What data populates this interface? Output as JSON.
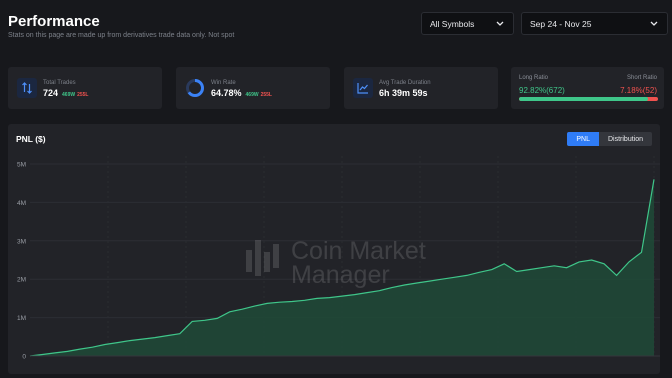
{
  "header": {
    "title": "Performance",
    "subtitle": "Stats on this page are made up from derivatives trade data only. Not spot"
  },
  "filters": {
    "symbol": "All Symbols",
    "date_range": "Sep 24 - Nov 25"
  },
  "stats": {
    "total_trades": {
      "label": "Total Trades",
      "value": "724",
      "win": "469W",
      "loss": "255L",
      "icon": "arrows-updown-icon"
    },
    "win_rate": {
      "label": "Win Rate",
      "value": "64.78%",
      "win": "469W",
      "loss": "255L",
      "fraction": 0.6478,
      "icon": "donut-icon"
    },
    "avg_duration": {
      "label": "Avg Trade Duration",
      "value": "6h 39m 59s",
      "icon": "chart-line-icon"
    },
    "ratio": {
      "long_label": "Long Ratio",
      "short_label": "Short Ratio",
      "long_value": "92.82%(672)",
      "short_value": "7.18%(52)",
      "long_fraction": 0.9282
    }
  },
  "chart": {
    "title": "PNL ($)",
    "tabs": [
      "PNL",
      "Distribution"
    ],
    "active_tab": "PNL",
    "watermark_line1": "Coin Market",
    "watermark_line2": "Manager",
    "colors": {
      "line": "#3fc68a",
      "fill": "#1f4a37",
      "accent": "#2f7cf6",
      "loss": "#f0524f"
    }
  },
  "chart_data": {
    "type": "area",
    "title": "PNL ($)",
    "xlabel": "",
    "ylabel": "",
    "ylim": [
      0,
      5000000
    ],
    "yticks": [
      "0",
      "1M",
      "2M",
      "3M",
      "4M",
      "5M"
    ],
    "ytick_values": [
      0,
      1000000,
      2000000,
      3000000,
      4000000,
      5000000
    ],
    "grid": true,
    "x": [
      0,
      2,
      4,
      6,
      8,
      10,
      12,
      14,
      16,
      18,
      20,
      22,
      24,
      26,
      28,
      30,
      32,
      34,
      36,
      38,
      40,
      42,
      44,
      46,
      48,
      50,
      52,
      54,
      56,
      58,
      60,
      62,
      64,
      66,
      68,
      70,
      72,
      74,
      76,
      78,
      80,
      82,
      84,
      86,
      88,
      90,
      92,
      94,
      96,
      98,
      100
    ],
    "series": [
      {
        "values": [
          0,
          40000,
          80000,
          120000,
          180000,
          230000,
          300000,
          350000,
          400000,
          440000,
          480000,
          530000,
          580000,
          900000,
          930000,
          980000,
          1150000,
          1220000,
          1300000,
          1370000,
          1400000,
          1420000,
          1450000,
          1500000,
          1520000,
          1560000,
          1600000,
          1650000,
          1700000,
          1780000,
          1850000,
          1900000,
          1950000,
          2000000,
          2050000,
          2100000,
          2180000,
          2250000,
          2400000,
          2200000,
          2250000,
          2300000,
          2350000,
          2300000,
          2450000,
          2500000,
          2400000,
          2100000,
          2450000,
          2700000,
          4600000
        ]
      }
    ]
  }
}
